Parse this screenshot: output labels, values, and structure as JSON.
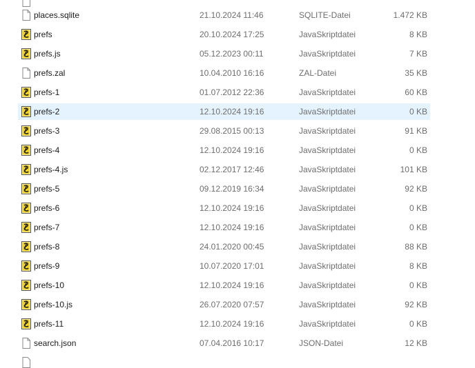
{
  "files": [
    {
      "name": "places.sqlite",
      "date": "21.10.2024 11:46",
      "type": "SQLITE-Datei",
      "size": "1.472 KB",
      "icon": "generic-file-icon"
    },
    {
      "name": "prefs",
      "date": "20.10.2024 17:25",
      "type": "JavaSkriptdatei",
      "size": "8 KB",
      "icon": "javascript-file-icon"
    },
    {
      "name": "prefs.js",
      "date": "05.12.2023 00:11",
      "type": "JavaSkriptdatei",
      "size": "7 KB",
      "icon": "javascript-file-icon"
    },
    {
      "name": "prefs.zal",
      "date": "10.04.2010 16:16",
      "type": "ZAL-Datei",
      "size": "35 KB",
      "icon": "generic-file-icon"
    },
    {
      "name": "prefs-1",
      "date": "01.07.2012 22:36",
      "type": "JavaSkriptdatei",
      "size": "60 KB",
      "icon": "javascript-file-icon"
    },
    {
      "name": "prefs-2",
      "date": "12.10.2024 19:16",
      "type": "JavaSkriptdatei",
      "size": "0 KB",
      "icon": "javascript-file-icon",
      "selected": true
    },
    {
      "name": "prefs-3",
      "date": "29.08.2015 00:13",
      "type": "JavaSkriptdatei",
      "size": "91 KB",
      "icon": "javascript-file-icon"
    },
    {
      "name": "prefs-4",
      "date": "12.10.2024 19:16",
      "type": "JavaSkriptdatei",
      "size": "0 KB",
      "icon": "javascript-file-icon"
    },
    {
      "name": "prefs-4.js",
      "date": "02.12.2017 12:46",
      "type": "JavaSkriptdatei",
      "size": "101 KB",
      "icon": "javascript-file-icon"
    },
    {
      "name": "prefs-5",
      "date": "09.12.2019 16:34",
      "type": "JavaSkriptdatei",
      "size": "92 KB",
      "icon": "javascript-file-icon"
    },
    {
      "name": "prefs-6",
      "date": "12.10.2024 19:16",
      "type": "JavaSkriptdatei",
      "size": "0 KB",
      "icon": "javascript-file-icon"
    },
    {
      "name": "prefs-7",
      "date": "12.10.2024 19:16",
      "type": "JavaSkriptdatei",
      "size": "0 KB",
      "icon": "javascript-file-icon"
    },
    {
      "name": "prefs-8",
      "date": "24.01.2020 00:45",
      "type": "JavaSkriptdatei",
      "size": "88 KB",
      "icon": "javascript-file-icon"
    },
    {
      "name": "prefs-9",
      "date": "10.07.2020 17:01",
      "type": "JavaSkriptdatei",
      "size": "8 KB",
      "icon": "javascript-file-icon"
    },
    {
      "name": "prefs-10",
      "date": "12.10.2024 19:16",
      "type": "JavaSkriptdatei",
      "size": "0 KB",
      "icon": "javascript-file-icon"
    },
    {
      "name": "prefs-10.js",
      "date": "26.07.2020 07:57",
      "type": "JavaSkriptdatei",
      "size": "92 KB",
      "icon": "javascript-file-icon"
    },
    {
      "name": "prefs-11",
      "date": "12.10.2024 19:16",
      "type": "JavaSkriptdatei",
      "size": "0 KB",
      "icon": "javascript-file-icon"
    },
    {
      "name": "search.json",
      "date": "07.04.2016 10:17",
      "type": "JSON-Datei",
      "size": "12 KB",
      "icon": "generic-file-icon"
    }
  ],
  "colors": {
    "selection": "#e5f3ff",
    "secondary_text": "#6d6d6d",
    "js_icon_yellow": "#f2d42b"
  }
}
